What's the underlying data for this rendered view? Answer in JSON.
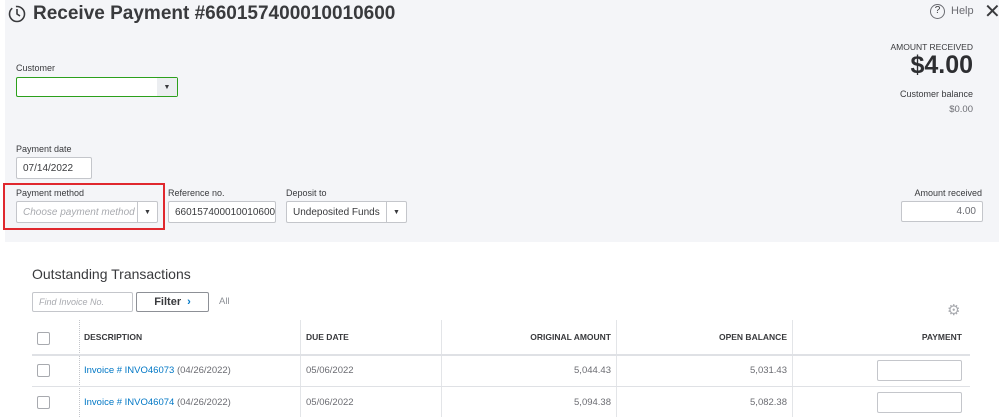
{
  "header": {
    "title": "Receive Payment #660157400010010600",
    "help_label": "Help"
  },
  "summary": {
    "amount_received_label": "AMOUNT RECEIVED",
    "amount_received": "$4.00",
    "customer_balance_label": "Customer balance",
    "customer_balance": "$0.00"
  },
  "form": {
    "customer_label": "Customer",
    "customer_value": "",
    "payment_date_label": "Payment date",
    "payment_date": "07/14/2022",
    "payment_method_label": "Payment method",
    "payment_method_placeholder": "Choose payment method",
    "reference_label": "Reference no.",
    "reference_value": "660157400010010600",
    "deposit_label": "Deposit to",
    "deposit_value": "Undeposited Funds",
    "amount_label": "Amount received",
    "amount_value": "4.00"
  },
  "transactions": {
    "title": "Outstanding Transactions",
    "find_placeholder": "Find Invoice No.",
    "filter_label": "Filter",
    "filter_value": "All",
    "columns": [
      "DESCRIPTION",
      "DUE DATE",
      "ORIGINAL AMOUNT",
      "OPEN BALANCE",
      "PAYMENT"
    ],
    "rows": [
      {
        "link": "Invoice # INVO46073",
        "date": "(04/26/2022)",
        "due": "05/06/2022",
        "original": "5,044.43",
        "open": "5,031.43",
        "payment": ""
      },
      {
        "link": "Invoice # INVO46074",
        "date": "(04/26/2022)",
        "due": "05/06/2022",
        "original": "5,094.38",
        "open": "5,082.38",
        "payment": ""
      }
    ]
  },
  "colors": {
    "panel": "#f4f5f8",
    "link": "#0077c5",
    "highlight": "#e0282e",
    "customer_border": "#2ca01c"
  }
}
